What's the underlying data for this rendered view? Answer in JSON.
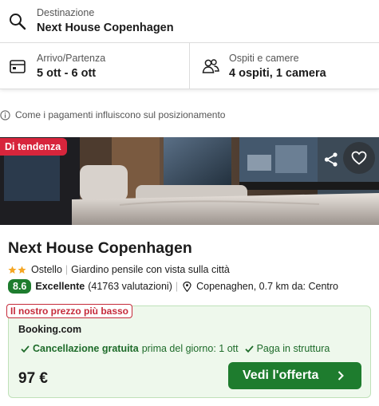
{
  "search": {
    "destination_label": "Destinazione",
    "destination_value": "Next House Copenhagen",
    "dates_label": "Arrivo/Partenza",
    "dates_value": "5 ott - 6 ott",
    "guests_label": "Ospiti e camere",
    "guests_value": "4 ospiti, 1 camera"
  },
  "info_text": "Come i pagamenti influiscono sul posizionamento",
  "listing": {
    "badge": "Di tendenza",
    "name": "Next House Copenhagen",
    "stars": 2,
    "type": "Ostello",
    "feature": "Giardino pensile con vista sulla città",
    "score": "8.6",
    "rating_word": "Excellente",
    "reviews": "(41763 valutazioni)",
    "location": "Copenaghen, 0.7 km da: Centro"
  },
  "deal": {
    "tag": "Il nostro prezzo più basso",
    "provider": "Booking.com",
    "cancel_bold": "Cancellazione gratuita",
    "cancel_detail": "prima del giorno: 1 ott",
    "pay_at_property": "Paga in struttura",
    "price": "97 €",
    "cta": "Vedi l'offerta"
  },
  "colors": {
    "badge_red": "#d7253c",
    "score_green": "#1e7c2e",
    "deal_bg": "#eef8ec",
    "star_orange": "#f5a623"
  },
  "icons": [
    "search-icon",
    "calendar-icon",
    "guests-icon",
    "info-icon",
    "share-icon",
    "heart-icon",
    "star-icon",
    "pin-icon",
    "check-icon",
    "chevron-right-icon"
  ]
}
